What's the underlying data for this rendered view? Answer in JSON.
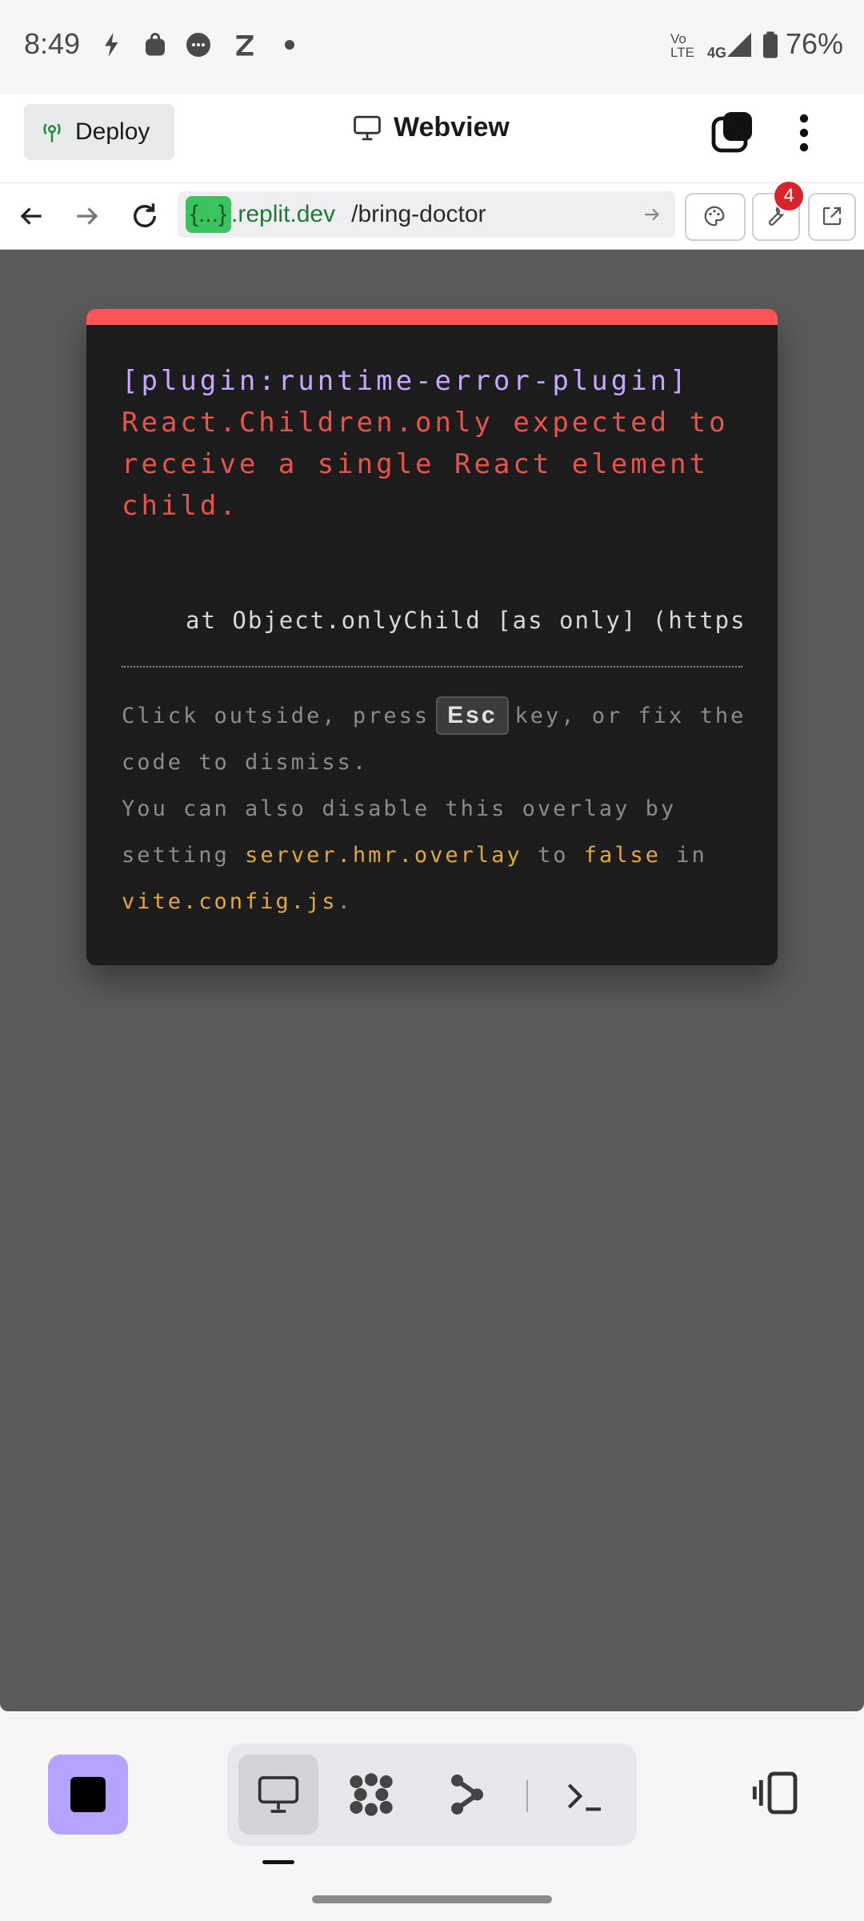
{
  "status_bar": {
    "time": "8:49",
    "network": "4G",
    "volte": "Vo LTE",
    "battery": "76%",
    "icons": [
      "notification-icon",
      "shopping-bag-icon",
      "chat-icon",
      "z-icon",
      "dot-icon",
      "signal-icon",
      "battery-icon"
    ]
  },
  "header": {
    "deploy_label": "Deploy",
    "title": "Webview"
  },
  "url_bar": {
    "repl_badge": "{...}",
    "domain": ".replit.dev",
    "path": "/bring-doctor",
    "devtools_badge_count": "4"
  },
  "error_overlay": {
    "plugin": "[plugin:runtime-error-plugin]",
    "message": "React.Children.only expected to receive a single React element child.",
    "stack": "at Object.onlyChild [as only] (https",
    "tip": {
      "part1": "Click outside, press",
      "key": "Esc",
      "part2": "key, or fix the code to dismiss.",
      "part3": "You can also disable this overlay by setting",
      "code1": "server.hmr.overlay",
      "part4": "to",
      "code2": "false",
      "part5": "in",
      "code3": "vite.config.js",
      "part6": "."
    },
    "accent_color": "#ff5555"
  },
  "colors": {
    "stop_button": "#b6a3ff",
    "webview_bg": "#5a5a5a"
  }
}
